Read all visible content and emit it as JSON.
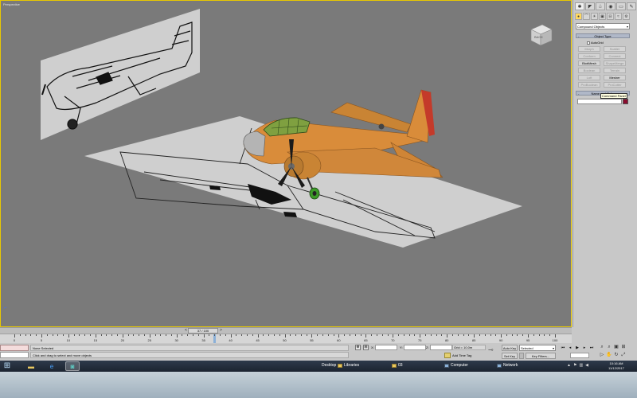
{
  "viewport": {
    "label": "Perspective",
    "viewcube_label": "BACK",
    "axis_glyph": "axis-tripod-icon"
  },
  "command_panel": {
    "tabs": [
      "create-icon",
      "modify-icon",
      "hierarchy-icon",
      "motion-icon",
      "display-icon",
      "utilities-icon"
    ],
    "category_dropdown": "Compound Objects",
    "object_type_header": "Object Type",
    "autogrid_label": "AutoGrid",
    "buttons": [
      {
        "label": "Morph",
        "enabled": false
      },
      {
        "label": "Scatter",
        "enabled": false
      },
      {
        "label": "Conform",
        "enabled": false
      },
      {
        "label": "Connect",
        "enabled": false
      },
      {
        "label": "BlobMesh",
        "enabled": true
      },
      {
        "label": "ShapeMerge",
        "enabled": false
      },
      {
        "label": "Boolean",
        "enabled": false
      },
      {
        "label": "Terrain",
        "enabled": false
      },
      {
        "label": "Loft",
        "enabled": false
      },
      {
        "label": "Mesher",
        "enabled": true
      },
      {
        "label": "ProBoolean",
        "enabled": false
      },
      {
        "label": "ProCutter",
        "enabled": false
      }
    ],
    "name_color_header": "Name and Color",
    "tooltip": "Command Panel",
    "color_swatch": "#8a0b2e"
  },
  "timeline": {
    "frame_readout": "37 / 100",
    "current_frame": 37,
    "total_frames": 100,
    "ticks": [
      "0",
      "5",
      "10",
      "15",
      "20",
      "25",
      "30",
      "35",
      "40",
      "45",
      "50",
      "55",
      "60",
      "65",
      "70",
      "75",
      "80",
      "85",
      "90",
      "95",
      "100"
    ]
  },
  "status": {
    "selection": "None Selected",
    "prompt": "Click and drag to select and move objects",
    "x_label": "X:",
    "y_label": "Y:",
    "z_label": "Z:",
    "grid": "Grid = 10.0m",
    "add_time_tag": "Add Time Tag",
    "auto_key": "Auto Key",
    "set_key": "Set Key",
    "selected_dropdown": "Selected",
    "key_filters": "Key Filters..."
  },
  "taskbar": {
    "desktop": "Desktop",
    "libraries": "Libraries",
    "folder": "03",
    "computer": "Computer",
    "network": "Network",
    "time": "10:16 AM",
    "date": "11/12/2017"
  },
  "colors": {
    "viewport_bg": "#7a7a7a",
    "active_border": "#e8c800",
    "plane_body": "#d98c3a",
    "tail_tip": "#c43a2a"
  }
}
